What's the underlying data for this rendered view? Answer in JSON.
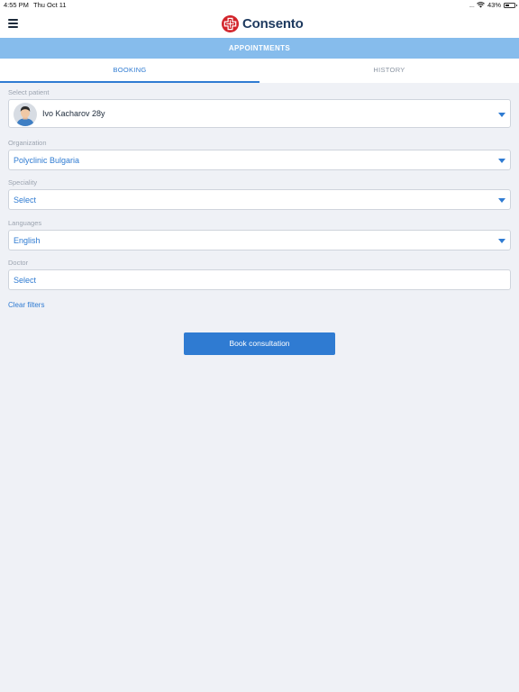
{
  "status_bar": {
    "time": "4:55 PM",
    "date": "Thu Oct 11",
    "battery_text": "43%",
    "battery_percent": 43
  },
  "header": {
    "brand_name": "Consento",
    "brand_color": "#d2232a"
  },
  "section": {
    "title": "APPOINTMENTS"
  },
  "tabs": [
    {
      "label": "BOOKING",
      "active": true
    },
    {
      "label": "HISTORY",
      "active": false
    }
  ],
  "form": {
    "patient": {
      "label": "Select patient",
      "value": "Ivo Kacharov 28y"
    },
    "organization": {
      "label": "Organization",
      "value": "Polyclinic Bulgaria"
    },
    "speciality": {
      "label": "Speciality",
      "value": "Select"
    },
    "languages": {
      "label": "Languages",
      "value": "English"
    },
    "doctor": {
      "label": "Doctor",
      "value": "Select"
    }
  },
  "actions": {
    "clear_filters": "Clear filters",
    "book_button": "Book consultation"
  },
  "colors": {
    "accent": "#2f7bd2",
    "section_bar": "#86bcec",
    "background": "#eff1f6"
  }
}
